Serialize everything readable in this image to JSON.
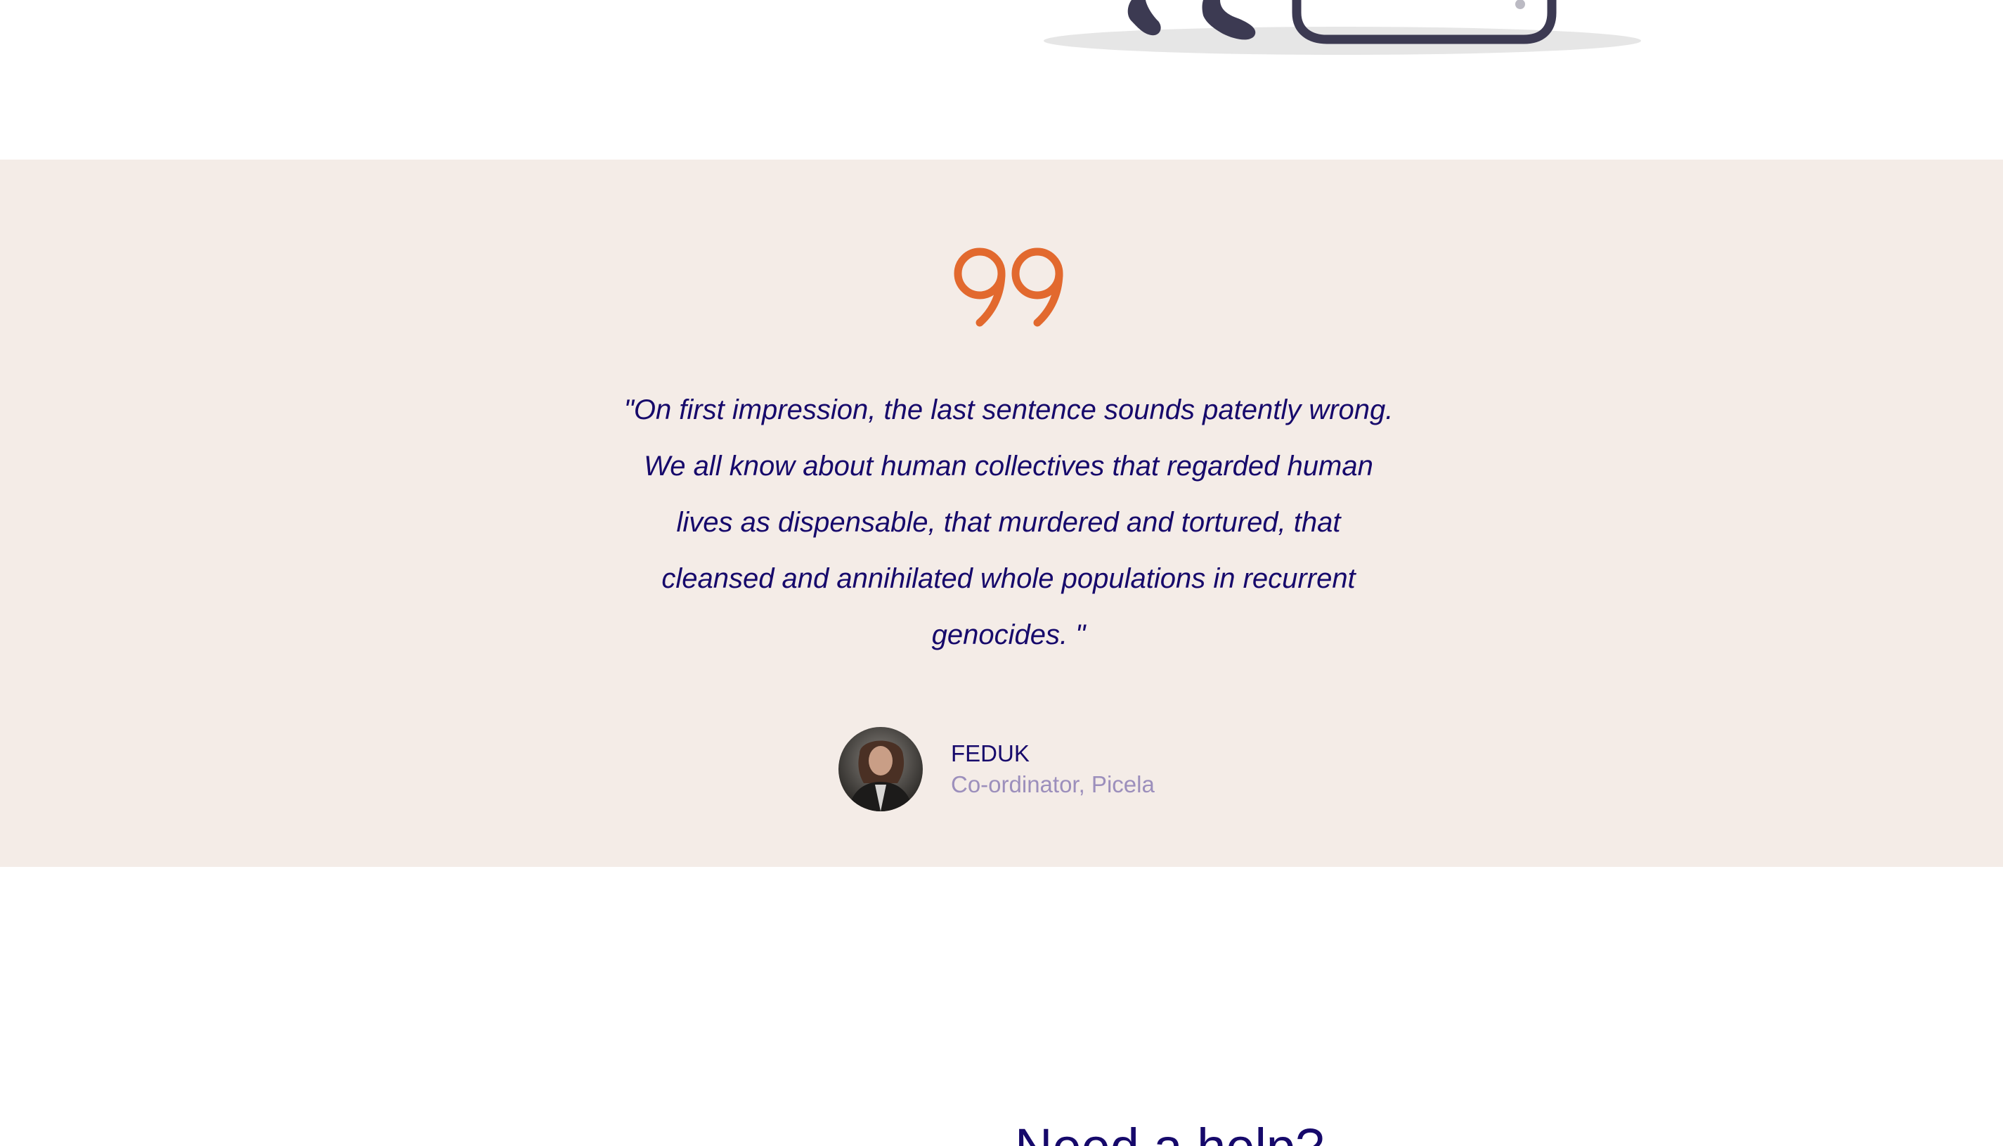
{
  "colors": {
    "page_background": "#ffffff",
    "band_background": "#f4ece7",
    "accent_quote_mark": "#e2692e",
    "primary_text": "#16096b",
    "muted_text": "#9c8fbc",
    "illustration_dark": "#3c3a52",
    "illustration_shadow": "#e6e6e6"
  },
  "top_illustration": {
    "icon": "person-with-laptop-illustration"
  },
  "testimonial": {
    "quote_icon": "quote-mark-icon",
    "quote": "\"On first impression, the last sentence sounds patently wrong. We all know about human collectives that regarded human lives as dispensable, that murdered and tortured, that cleansed and annihilated whole populations in recurrent genocides. \"",
    "author": {
      "avatar_icon": "avatar-photo",
      "name": "FEDUK",
      "role": "Co-ordinator, Picela"
    }
  },
  "help_section": {
    "heading": "Need a help?"
  }
}
